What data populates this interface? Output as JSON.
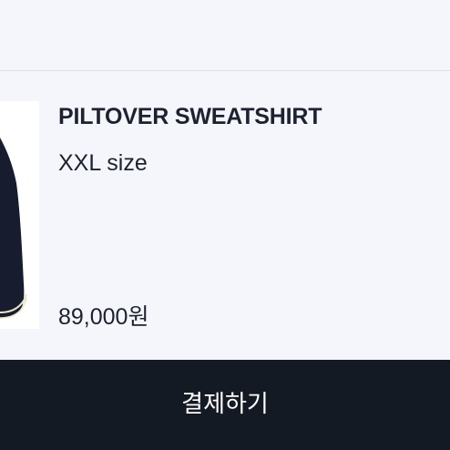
{
  "product": {
    "name": "PILTOVER SWEATSHIRT",
    "size": "XXL size",
    "price": "89,000원",
    "image": "sweatshirt-thumbnail"
  },
  "checkout": {
    "button_label": "결제하기"
  },
  "colors": {
    "background": "#f5f6fc",
    "text": "#1d2230",
    "button": "#131a24",
    "button_text": "#ffffff",
    "garment": "#171c2e",
    "trim": "#e9e4c2"
  }
}
